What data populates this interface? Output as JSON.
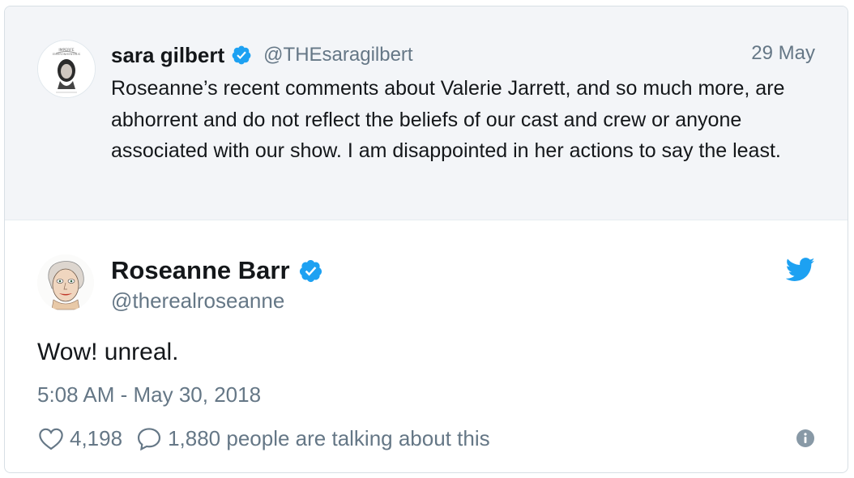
{
  "quoted_tweet": {
    "display_name": "sara gilbert",
    "handle": "@THEsaragilbert",
    "date": "29 May",
    "text": "Roseanne’s recent comments about Valerie Jarrett, and so much more, are abhorrent and do not reflect the beliefs of our cast and crew or anyone associated with our show. I am disappointed in her actions to say the least.",
    "avatar_caption": "IMPERFE ENVIRONMENTALIS"
  },
  "tweet": {
    "display_name": "Roseanne Barr",
    "handle": "@therealroseanne",
    "text": "Wow! unreal.",
    "timestamp": "5:08 AM - May 30, 2018",
    "like_count": "4,198",
    "talking_text": "1,880 people are talking about this"
  },
  "icons": {
    "verified": "verified-badge-icon",
    "brand": "twitter-bird-icon",
    "like": "heart-icon",
    "reply": "speech-bubble-icon",
    "info": "info-icon"
  },
  "colors": {
    "verified": "#1da1f2",
    "twitter_blue": "#1da1f2",
    "secondary_text": "#657786",
    "primary_text": "#14171a",
    "quoted_background": "#f3f5f8"
  }
}
